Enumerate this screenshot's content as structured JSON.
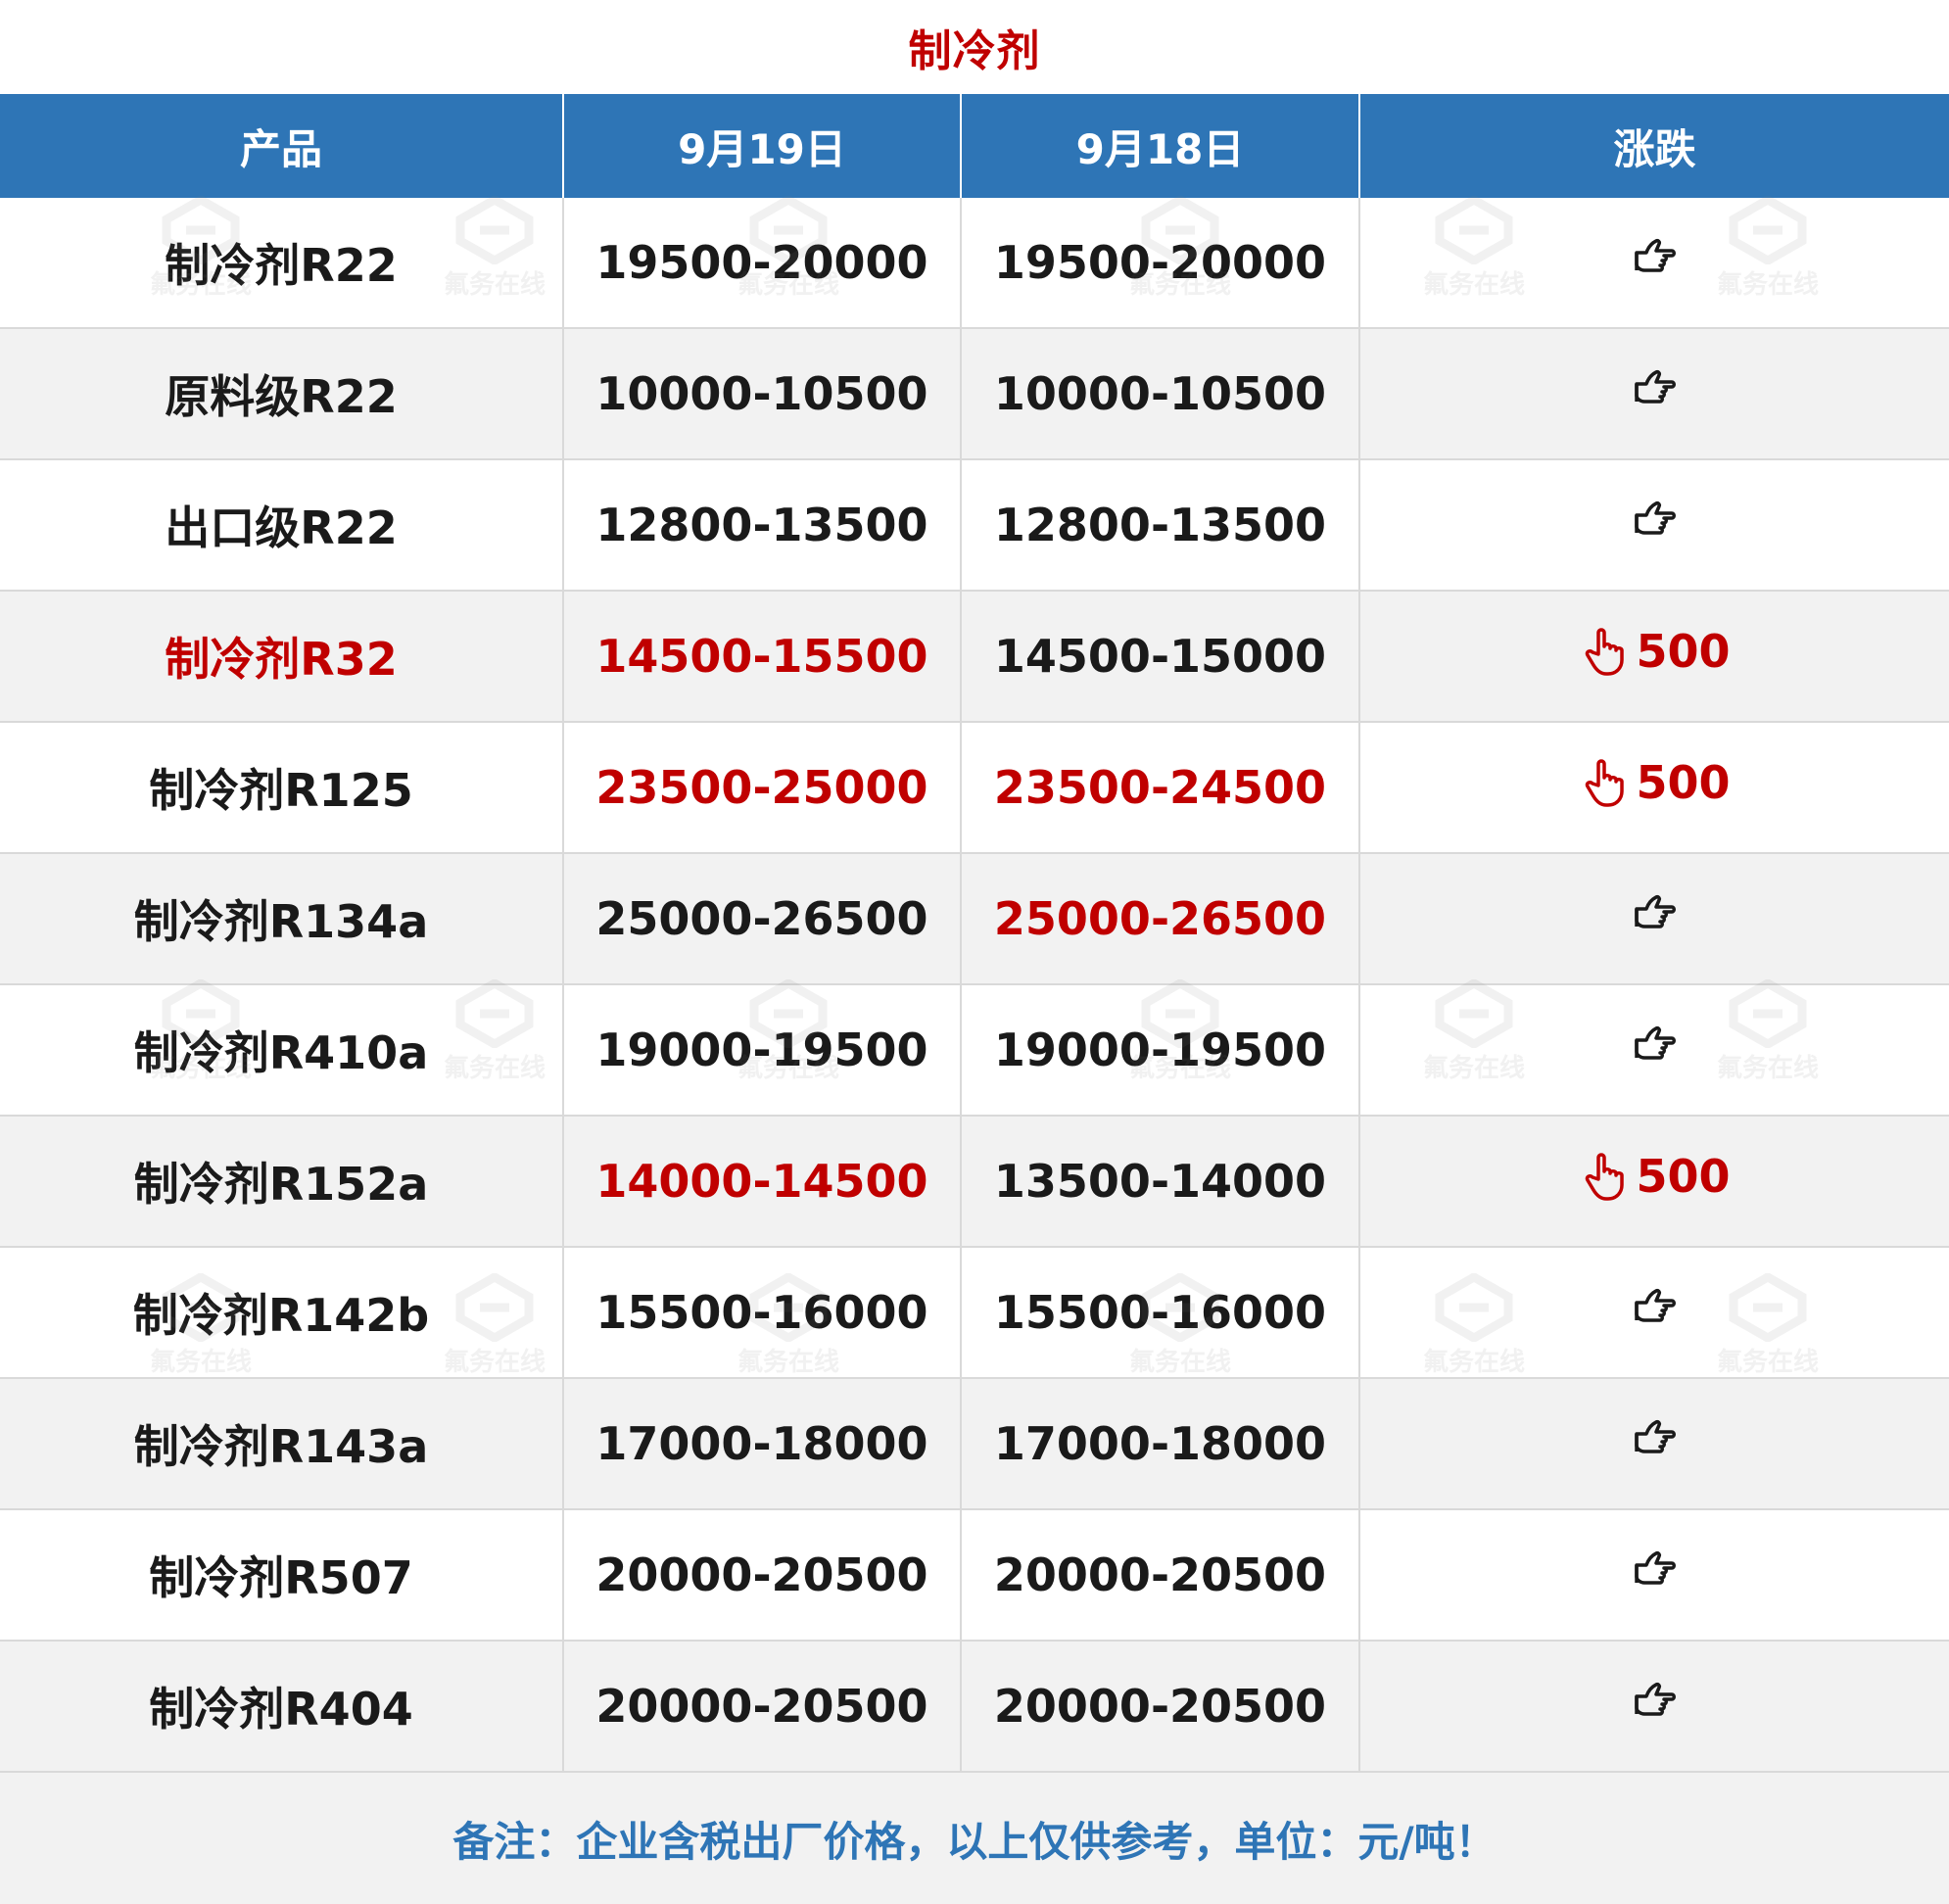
{
  "title": "制冷剂",
  "headers": {
    "product": "产品",
    "date1": "9月19日",
    "date2": "9月18日",
    "change": "涨跌"
  },
  "rows": [
    {
      "product": "制冷剂R22",
      "d1": "19500-20000",
      "d2": "19500-20000",
      "change": "",
      "trend": "flat",
      "product_red": false,
      "d1_red": false,
      "d2_red": false
    },
    {
      "product": "原料级R22",
      "d1": "10000-10500",
      "d2": "10000-10500",
      "change": "",
      "trend": "flat",
      "product_red": false,
      "d1_red": false,
      "d2_red": false
    },
    {
      "product": "出口级R22",
      "d1": "12800-13500",
      "d2": "12800-13500",
      "change": "",
      "trend": "flat",
      "product_red": false,
      "d1_red": false,
      "d2_red": false
    },
    {
      "product": "制冷剂R32",
      "d1": "14500-15500",
      "d2": "14500-15000",
      "change": "500",
      "trend": "up",
      "product_red": true,
      "d1_red": true,
      "d2_red": false
    },
    {
      "product": "制冷剂R125",
      "d1": "23500-25000",
      "d2": "23500-24500",
      "change": "500",
      "trend": "up",
      "product_red": false,
      "d1_red": true,
      "d2_red": true
    },
    {
      "product": "制冷剂R134a",
      "d1": "25000-26500",
      "d2": "25000-26500",
      "change": "",
      "trend": "flat",
      "product_red": false,
      "d1_red": false,
      "d2_red": true
    },
    {
      "product": "制冷剂R410a",
      "d1": "19000-19500",
      "d2": "19000-19500",
      "change": "",
      "trend": "flat",
      "product_red": false,
      "d1_red": false,
      "d2_red": false
    },
    {
      "product": "制冷剂R152a",
      "d1": "14000-14500",
      "d2": "13500-14000",
      "change": "500",
      "trend": "up",
      "product_red": false,
      "d1_red": true,
      "d2_red": false
    },
    {
      "product": "制冷剂R142b",
      "d1": "15500-16000",
      "d2": "15500-16000",
      "change": "",
      "trend": "flat",
      "product_red": false,
      "d1_red": false,
      "d2_red": false
    },
    {
      "product": "制冷剂R143a",
      "d1": "17000-18000",
      "d2": "17000-18000",
      "change": "",
      "trend": "flat",
      "product_red": false,
      "d1_red": false,
      "d2_red": false
    },
    {
      "product": "制冷剂R507",
      "d1": "20000-20500",
      "d2": "20000-20500",
      "change": "",
      "trend": "flat",
      "product_red": false,
      "d1_red": false,
      "d2_red": false
    },
    {
      "product": "制冷剂R404",
      "d1": "20000-20500",
      "d2": "20000-20500",
      "change": "",
      "trend": "flat",
      "product_red": false,
      "d1_red": false,
      "d2_red": false
    }
  ],
  "footer_note": "备注：企业含税出厂价格，以上仅供参考，单位：元/吨！",
  "watermark_text": "氟务在线",
  "colors": {
    "header_bg": "#2e75b6",
    "accent_red": "#c00000",
    "row_alt_bg": "#f2f2f2",
    "footer_text": "#2e75b6"
  },
  "icons": {
    "flat": "hand-pointing-right-icon",
    "up": "hand-pointing-up-icon"
  }
}
